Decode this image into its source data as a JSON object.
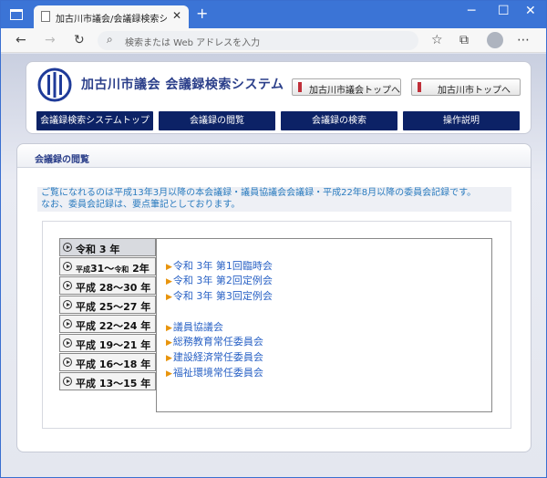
{
  "browser": {
    "tab_title": "加古川市議会/会議録検索システム",
    "address_placeholder": "検索または Web アドレスを入力"
  },
  "header": {
    "site_title": "加古川市議会 会議録検索システム",
    "top_links": [
      "加古川市議会トップへ",
      "加古川市トップへ"
    ],
    "nav": [
      "会議録検索システムトップ",
      "会議録の閲覧",
      "会議録の検索",
      "操作説明"
    ]
  },
  "section": {
    "title": "会議録の閲覧",
    "notice": [
      "ご覧になれるのは平成13年3月以降の本会議録・議員協議会会議録・平成22年8月以降の委員会記録です。",
      "なお、委員会記録は、要点筆記としております。"
    ]
  },
  "years": [
    {
      "label": "令和 3 年",
      "active": true
    },
    {
      "prefix1": "平成",
      "main1": "31～",
      "prefix2": "令和",
      "main2": " 2年"
    },
    {
      "label": "平成 28～30 年"
    },
    {
      "label": "平成 25～27 年"
    },
    {
      "label": "平成 22～24 年"
    },
    {
      "label": "平成 19～21 年"
    },
    {
      "label": "平成 16～18 年"
    },
    {
      "label": "平成 13～15 年"
    }
  ],
  "meetings": [
    "令和 3年 第1回臨時会",
    "令和 3年 第2回定例会",
    "令和 3年 第3回定例会",
    "議員協議会",
    "総務教育常任委員会",
    "建設経済常任委員会",
    "福祉環境常任委員会"
  ]
}
